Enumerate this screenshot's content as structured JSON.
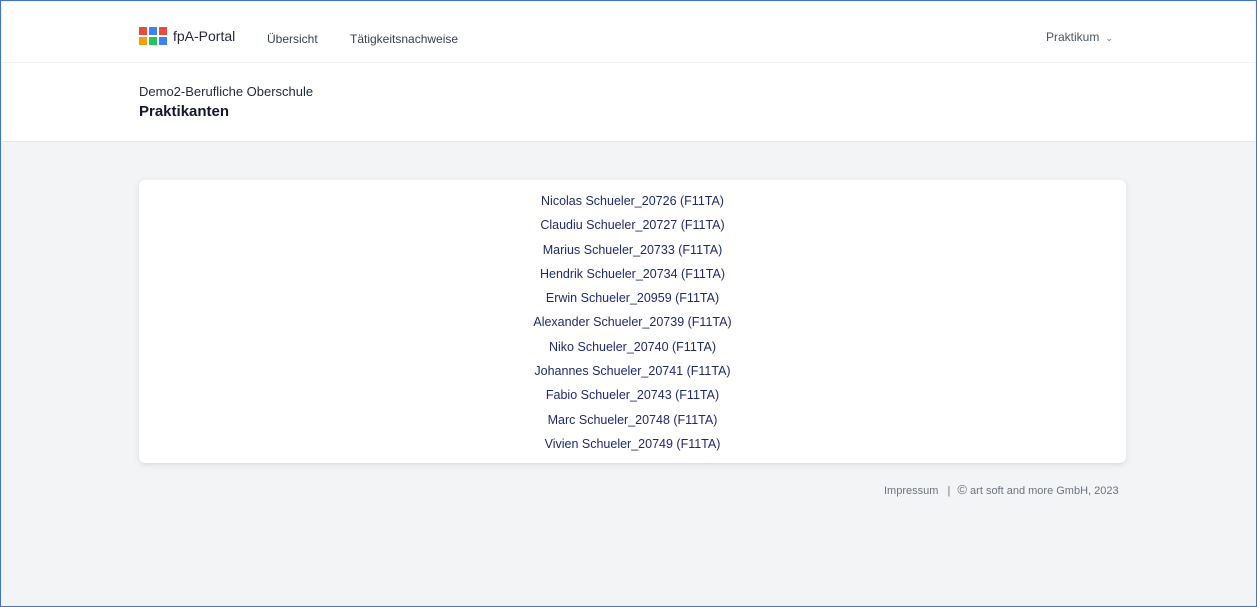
{
  "navbar": {
    "brand": "fpA-Portal",
    "logo_colors": [
      "#e74c3c",
      "#3b82f6",
      "#e74c3c",
      "#f59e0b",
      "#22c55e",
      "#3b82f6"
    ],
    "links": [
      {
        "label": "Übersicht"
      },
      {
        "label": "Tätigkeitsnachweise"
      }
    ],
    "dropdown": {
      "label": "Praktikum",
      "icon": "chevron-down-icon"
    }
  },
  "header": {
    "school": "Demo2-Berufliche Oberschule",
    "title": "Praktikanten"
  },
  "students": [
    "Nicolas Schueler_20726 (F11TA)",
    "Claudiu Schueler_20727 (F11TA)",
    "Marius Schueler_20733 (F11TA)",
    "Hendrik Schueler_20734 (F11TA)",
    "Erwin Schueler_20959 (F11TA)",
    "Alexander Schueler_20739 (F11TA)",
    "Niko Schueler_20740 (F11TA)",
    "Johannes Schueler_20741 (F11TA)",
    "Fabio Schueler_20743 (F11TA)",
    "Marc Schueler_20748 (F11TA)",
    "Vivien Schueler_20749 (F11TA)"
  ],
  "footer": {
    "impressum": "Impressum",
    "separator": "|",
    "copyright_symbol": "©",
    "copyright": "art soft and more GmbH, 2023"
  }
}
